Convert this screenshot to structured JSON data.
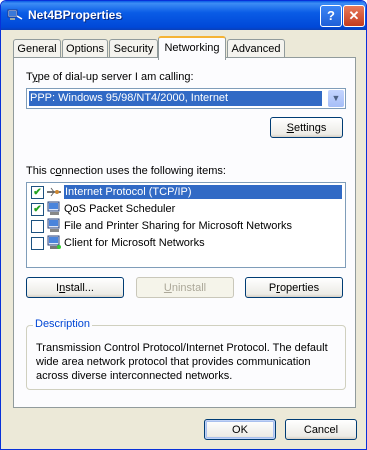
{
  "window": {
    "title": "Net4BProperties",
    "help_glyph": "?",
    "close_glyph": "✕"
  },
  "tabs": [
    "General",
    "Options",
    "Security",
    "Networking",
    "Advanced"
  ],
  "active_tab": "Networking",
  "server_type": {
    "label_prefix": "T",
    "label_accel": "y",
    "label_rest": "pe of dial-up server I am calling:",
    "value": "PPP: Windows 95/98/NT4/2000, Internet"
  },
  "settings_button": {
    "prefix": "",
    "accel": "S",
    "rest": "ettings"
  },
  "items_label": {
    "prefix": "This c",
    "accel": "o",
    "rest": "nnection uses the following items:"
  },
  "components": [
    {
      "label": "Internet Protocol (TCP/IP)",
      "checked": "✔",
      "selected": true,
      "icon": "protocol-icon"
    },
    {
      "label": "QoS Packet Scheduler",
      "checked": "✔",
      "selected": false,
      "icon": "network-service-icon"
    },
    {
      "label": "File and Printer Sharing for Microsoft Networks",
      "checked": "",
      "selected": false,
      "icon": "network-service-icon"
    },
    {
      "label": "Client for Microsoft Networks",
      "checked": "",
      "selected": false,
      "icon": "network-client-icon"
    }
  ],
  "buttons": {
    "install": {
      "prefix": "I",
      "accel": "n",
      "rest": "stall..."
    },
    "uninstall": {
      "prefix": "",
      "accel": "U",
      "rest": "ninstall"
    },
    "properties": {
      "prefix": "P",
      "accel": "r",
      "rest": "operties"
    },
    "ok": "OK",
    "cancel": "Cancel"
  },
  "description": {
    "title": "Description",
    "text": "Transmission Control Protocol/Internet Protocol. The default wide area network protocol that provides communication across diverse interconnected networks."
  },
  "colors": {
    "title_bar": "#0a5ce6",
    "selection": "#316ac5",
    "dialog_bg": "#ece9d8",
    "panel_bg": "#fcfcfe"
  }
}
